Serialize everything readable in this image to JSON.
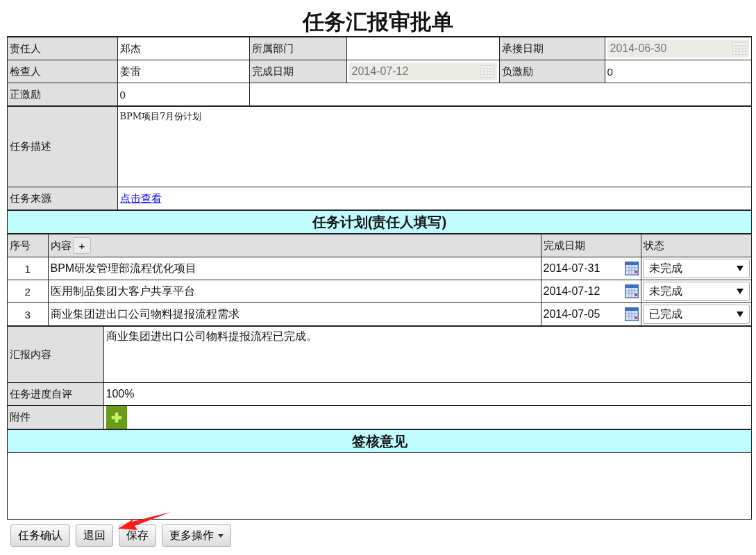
{
  "title": "任务汇报审批单",
  "info_rows": [
    [
      {
        "label": "责任人",
        "value": "郑杰",
        "kind": "text"
      },
      {
        "label": "所属部门",
        "kind": "text"
      },
      {
        "label": "承接日期",
        "value": "2014-06-30",
        "kind": "date"
      }
    ],
    [
      {
        "label": "检查人",
        "value": "姜雷",
        "kind": "text"
      },
      {
        "label": "完成日期",
        "value": "2014-07-12",
        "kind": "date"
      },
      {
        "label": "负激励",
        "value": "0",
        "kind": "text"
      }
    ],
    [
      {
        "label": "正激励",
        "value": "0",
        "kind": "text"
      }
    ]
  ],
  "description": {
    "label": "任务描述",
    "value": "BPM项目7月份计划"
  },
  "source": {
    "label": "任务来源",
    "link": "点击查看"
  },
  "plan": {
    "heading": "任务计划(责任人填写)",
    "columns": [
      "序号",
      "内容",
      "完成日期",
      "状态"
    ],
    "add_button": "+",
    "rows": [
      {
        "index": "1",
        "content": "BPM研发管理部流程优化项目",
        "date": "2014-07-31",
        "status": "未完成"
      },
      {
        "index": "2",
        "content": "医用制品集团大客户共享平台",
        "date": "2014-07-12",
        "status": "未完成"
      },
      {
        "index": "3",
        "content": "商业集团进出口公司物料提报流程需求",
        "date": "2014-07-05",
        "status": "已完成"
      }
    ]
  },
  "report": {
    "label": "汇报内容",
    "value": "商业集团进出口公司物料提报流程已完成。"
  },
  "progress": {
    "label": "任务进度自评",
    "value": "100%"
  },
  "attachment": {
    "label": "附件"
  },
  "review": {
    "heading": "签核意见"
  },
  "buttons": [
    {
      "label": "任务确认",
      "kind": "plain"
    },
    {
      "label": "退回",
      "kind": "plain"
    },
    {
      "label": "保存",
      "kind": "plain"
    },
    {
      "label": "更多操作",
      "kind": "dropdown"
    }
  ]
}
